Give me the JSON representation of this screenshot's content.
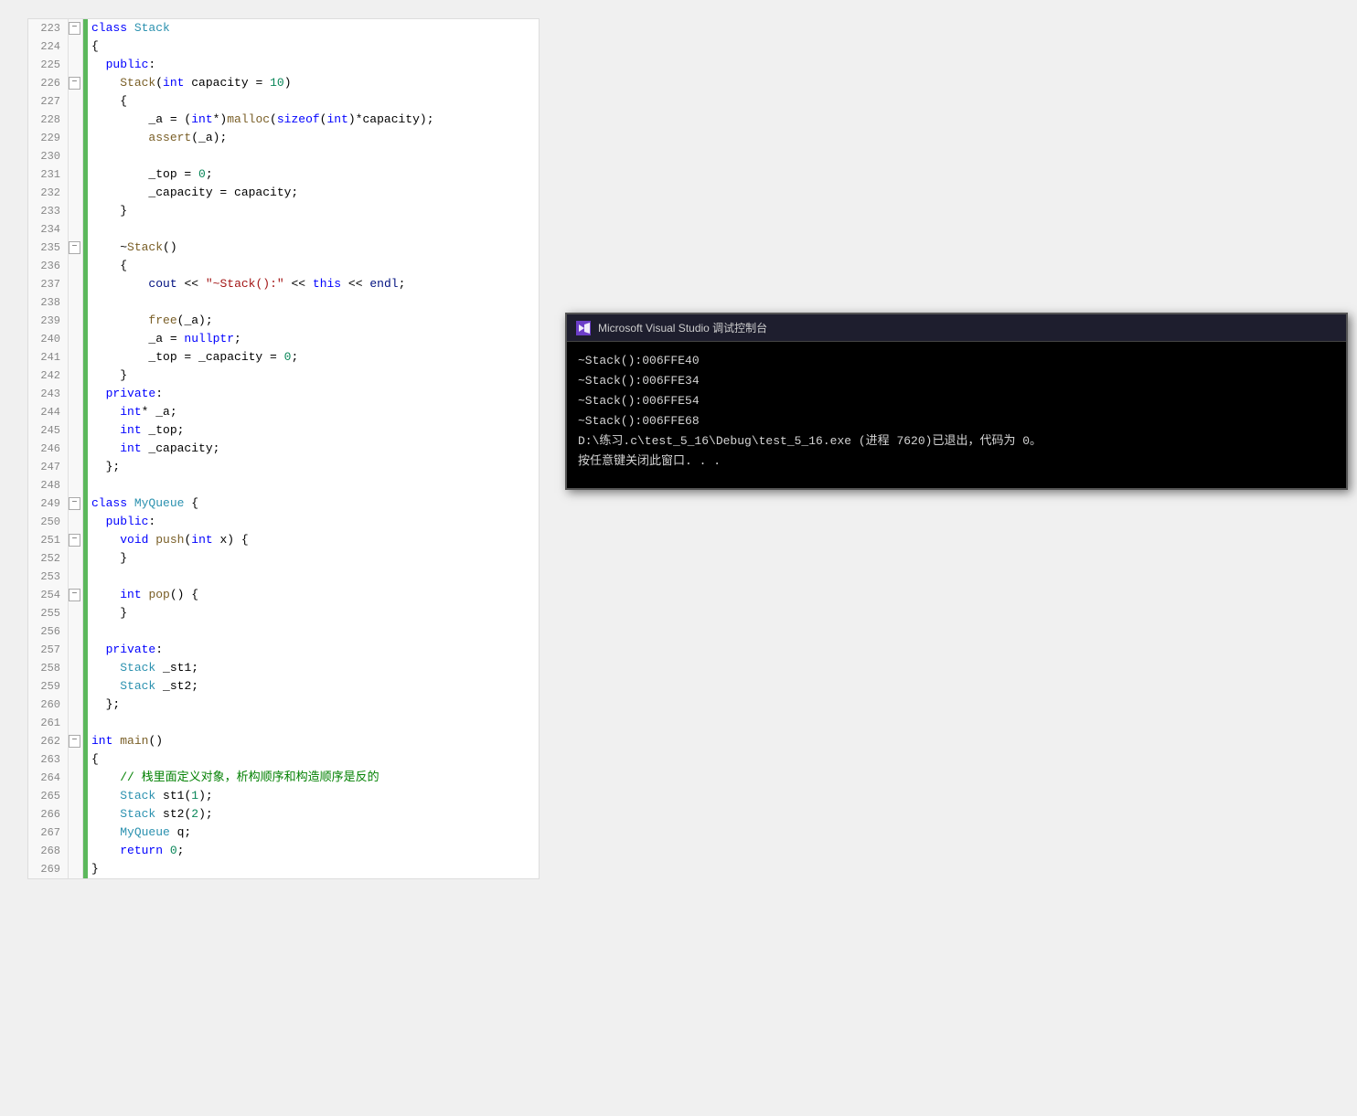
{
  "editor": {
    "lines": [
      {
        "num": "223",
        "indent_level": 0,
        "collapsible": true,
        "collapse_state": "open",
        "content_html": "<span class='blue'>class</span> <span class='cls'>Stack</span>"
      },
      {
        "num": "224",
        "content_html": "{"
      },
      {
        "num": "225",
        "content_html": "  <span class='blue'>public</span>:"
      },
      {
        "num": "226",
        "collapsible": true,
        "content_html": "    <span class='fn'>Stack</span>(<span class='blue'>int</span> capacity = <span class='num'>10</span>)"
      },
      {
        "num": "227",
        "content_html": "    {"
      },
      {
        "num": "228",
        "content_html": "        _a = (<span class='blue'>int</span>*)<span class='fn'>malloc</span>(<span class='blue'>sizeof</span>(<span class='blue'>int</span>)*capacity);"
      },
      {
        "num": "229",
        "content_html": "        <span class='fn'>assert</span>(_a);"
      },
      {
        "num": "230",
        "content_html": ""
      },
      {
        "num": "231",
        "content_html": "        _top = <span class='num'>0</span>;"
      },
      {
        "num": "232",
        "content_html": "        _capacity = capacity;"
      },
      {
        "num": "233",
        "content_html": "    }"
      },
      {
        "num": "234",
        "content_html": ""
      },
      {
        "num": "235",
        "collapsible": true,
        "content_html": "    ~<span class='fn'>Stack</span>()"
      },
      {
        "num": "236",
        "content_html": "    {"
      },
      {
        "num": "237",
        "content_html": "        <span class='var'>cout</span> &lt;&lt; <span class='str'>\"~Stack():\"</span> &lt;&lt; <span class='blue'>this</span> &lt;&lt; <span class='var'>endl</span>;"
      },
      {
        "num": "238",
        "content_html": ""
      },
      {
        "num": "239",
        "content_html": "        <span class='fn'>free</span>(_a);"
      },
      {
        "num": "240",
        "content_html": "        _a = <span class='blue'>nullptr</span>;"
      },
      {
        "num": "241",
        "content_html": "        _top = _capacity = <span class='num'>0</span>;"
      },
      {
        "num": "242",
        "content_html": "    }"
      },
      {
        "num": "243",
        "content_html": "  <span class='blue'>private</span>:"
      },
      {
        "num": "244",
        "content_html": "    <span class='blue'>int</span>* _a;"
      },
      {
        "num": "245",
        "content_html": "    <span class='blue'>int</span> _top;"
      },
      {
        "num": "246",
        "content_html": "    <span class='blue'>int</span> _capacity;"
      },
      {
        "num": "247",
        "content_html": "  };"
      },
      {
        "num": "248",
        "content_html": ""
      },
      {
        "num": "249",
        "collapsible": true,
        "content_html": "<span class='blue'>class</span> <span class='cls'>MyQueue</span> {"
      },
      {
        "num": "250",
        "content_html": "  <span class='blue'>public</span>:"
      },
      {
        "num": "251",
        "collapsible": true,
        "content_html": "    <span class='blue'>void</span> <span class='fn'>push</span>(<span class='blue'>int</span> x) {"
      },
      {
        "num": "252",
        "content_html": "    }"
      },
      {
        "num": "253",
        "content_html": ""
      },
      {
        "num": "254",
        "collapsible": true,
        "content_html": "    <span class='blue'>int</span> <span class='fn'>pop</span>() {"
      },
      {
        "num": "255",
        "content_html": "    }"
      },
      {
        "num": "256",
        "content_html": ""
      },
      {
        "num": "257",
        "content_html": "  <span class='blue'>private</span>:"
      },
      {
        "num": "258",
        "content_html": "    <span class='cls'>Stack</span> _st1;"
      },
      {
        "num": "259",
        "content_html": "    <span class='cls'>Stack</span> _st2;"
      },
      {
        "num": "260",
        "content_html": "  };"
      },
      {
        "num": "261",
        "content_html": ""
      },
      {
        "num": "262",
        "collapsible": true,
        "content_html": "<span class='blue'>int</span> <span class='fn'>main</span>()"
      },
      {
        "num": "263",
        "content_html": "{"
      },
      {
        "num": "264",
        "content_html": "    <span class='cmt'>// 栈里面定义对象，析构顺序和构造顺序是反的</span>"
      },
      {
        "num": "265",
        "content_html": "    <span class='cls'>Stack</span> st1(<span class='num'>1</span>);"
      },
      {
        "num": "266",
        "content_html": "    <span class='cls'>Stack</span> st2(<span class='num'>2</span>);"
      },
      {
        "num": "267",
        "content_html": "    <span class='cls'>MyQueue</span> q;"
      },
      {
        "num": "268",
        "content_html": "    <span class='blue'>return</span> <span class='num'>0</span>;"
      },
      {
        "num": "269",
        "content_html": "}"
      }
    ]
  },
  "console": {
    "title": "Microsoft Visual Studio 调试控制台",
    "icon_text": "VS",
    "lines": [
      "~Stack():006FFE40",
      "~Stack():006FFE34",
      "~Stack():006FFE54",
      "~Stack():006FFE68",
      "",
      "D:\\练习.c\\test_5_16\\Debug\\test_5_16.exe (进程 7620)已退出，代码为 0。",
      "按任意键关闭此窗口. . ."
    ]
  }
}
